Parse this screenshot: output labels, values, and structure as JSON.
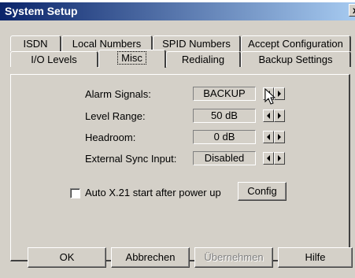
{
  "window": {
    "title": "System Setup",
    "close_label": "x"
  },
  "tabs_row1": [
    "ISDN",
    "Local Numbers",
    "SPID Numbers",
    "Accept Configuration"
  ],
  "tabs_row2": [
    "I/O Levels",
    "Misc",
    "Redialing",
    "Backup Settings"
  ],
  "active_tab": "Misc",
  "settings": {
    "alarm_signals": {
      "label": "Alarm Signals:",
      "value": "BACKUP"
    },
    "level_range": {
      "label": "Level Range:",
      "value": "50 dB"
    },
    "headroom": {
      "label": "Headroom:",
      "value": "0 dB"
    },
    "external_sync": {
      "label": "External Sync Input:",
      "value": "Disabled"
    }
  },
  "auto_x21": {
    "label": "Auto X.21 start after power up",
    "checked": false
  },
  "config_button": "Config",
  "buttons": {
    "ok": "OK",
    "cancel": "Abbrechen",
    "apply": "Übernehmen",
    "help": "Hilfe"
  }
}
